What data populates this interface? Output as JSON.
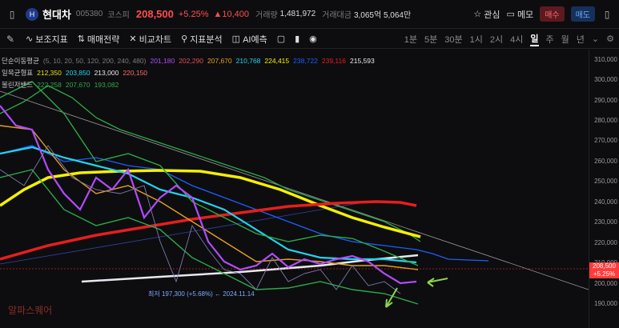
{
  "stock": {
    "name": "현대차",
    "code": "005380",
    "market": "코스피",
    "price": "208,500",
    "change_pct": "+5.25%",
    "change_abs": "▲10,400",
    "volume_label": "거래량",
    "volume": "1,481,972",
    "amount_label": "거래대금",
    "amount": "3,065억 5,064만"
  },
  "top_actions": {
    "watch": "관심",
    "memo": "메모",
    "buy": "매수",
    "sell": "매도"
  },
  "toolbar": {
    "tools": [
      "보조지표",
      "매매전략",
      "비교차트",
      "지표분석",
      "AI예측"
    ],
    "periods": [
      "1분",
      "5분",
      "30분",
      "1시",
      "2시",
      "4시",
      "일",
      "주",
      "월",
      "년"
    ],
    "active_period": "일"
  },
  "legend": {
    "ma": {
      "label": "단순이동평균",
      "params": "(5, 10, 20, 50, 120, 200, 240, 480)",
      "values": [
        "201,180",
        "202,290",
        "207,670",
        "210,768",
        "224,415",
        "238,722",
        "239,116",
        "215,593"
      ]
    },
    "ichimoku": {
      "label": "일목균형표",
      "values": [
        "212,350",
        "203,850",
        "213,000",
        "220,150"
      ]
    },
    "bollinger": {
      "label": "볼린저밴드",
      "values": [
        "222,258",
        "207,670",
        "193,082"
      ]
    }
  },
  "axis": {
    "ticks": [
      "310,000",
      "300,000",
      "290,000",
      "280,000",
      "270,000",
      "260,000",
      "250,000",
      "240,000",
      "230,000",
      "220,000",
      "210,000",
      "200,000",
      "190,000"
    ]
  },
  "current_tag": {
    "price": "208,500",
    "pct": "+5.25%"
  },
  "annotation": {
    "text": "최저 197,300 (+5.68%) ← 2024.11.14"
  },
  "watermark": "알파스퀘어",
  "colors": {
    "up": "#ff3b3b",
    "down": "#5b6cff",
    "yellow": "#f5f000",
    "red_ma": "#e61e1e",
    "cyan": "#22d3ee",
    "green": "#2ea84a"
  }
}
